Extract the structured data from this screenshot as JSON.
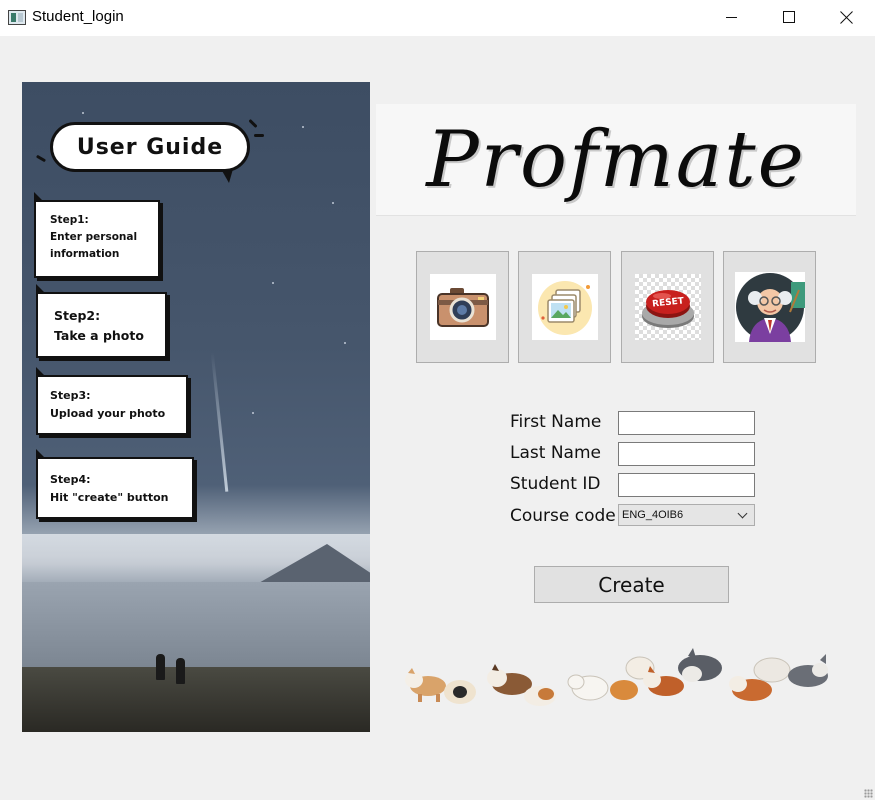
{
  "window": {
    "title": "Student_login",
    "icon": "app-window-icon",
    "controls": [
      "minimize",
      "maximize",
      "close"
    ]
  },
  "guide": {
    "title": "User Guide",
    "steps": [
      {
        "label": "Step1:",
        "text_lines": [
          "Enter personal",
          "information"
        ]
      },
      {
        "label": "Step2:",
        "text_lines": [
          "Take a photo"
        ]
      },
      {
        "label": "Step3:",
        "text_lines": [
          "Upload your photo"
        ]
      },
      {
        "label": "Step4:",
        "text_lines": [
          "Hit \"create\" button"
        ]
      }
    ]
  },
  "logo": {
    "text": "Profmate"
  },
  "toolbar": {
    "buttons": [
      {
        "icon": "camera-icon"
      },
      {
        "icon": "photo-gallery-icon"
      },
      {
        "icon": "reset-button-icon",
        "icon_text": "RESET"
      },
      {
        "icon": "professor-avatar-icon"
      }
    ]
  },
  "form": {
    "first_name": {
      "label": "First Name",
      "value": ""
    },
    "last_name": {
      "label": "Last Name",
      "value": ""
    },
    "student_id": {
      "label": "Student ID",
      "value": ""
    },
    "course_code": {
      "label": "Course code",
      "selected": "ENG_4OIB6"
    }
  },
  "create_button": {
    "label": "Create"
  },
  "colors": {
    "window_bg": "#f0f0f0",
    "button_bg": "#e1e1e1",
    "button_border": "#adadad",
    "reset_red": "#c8201e"
  }
}
